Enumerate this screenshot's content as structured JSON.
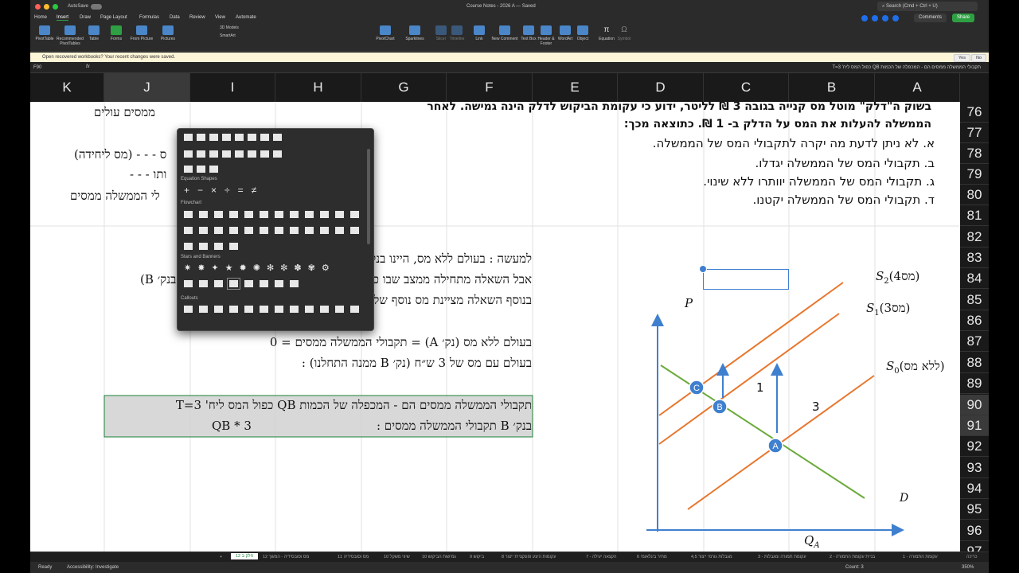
{
  "window": {
    "autosave_label": "AutoSave",
    "doc_title": "Course Notes - 2026 A — Saved",
    "search_placeholder": "Search (Cmd + Ctrl + U)"
  },
  "menu": {
    "tabs": [
      "Home",
      "Insert",
      "Draw",
      "Page Layout",
      "Formulas",
      "Data",
      "Review",
      "View",
      "Automate"
    ],
    "active": "Insert",
    "comments_label": "Comments",
    "share_label": "Share"
  },
  "ribbon": {
    "buttons": [
      "PivotTable",
      "Recommended PivotTables",
      "Table",
      "Forms",
      "From Picture",
      "Pictures"
    ],
    "smart_art": "SmartArt",
    "models_3d": "3D Models",
    "right_buttons": [
      "PivotChart",
      "Sparklines",
      "Slicer",
      "Timeline",
      "Link",
      "New Comment",
      "Text Box",
      "Header & Footer",
      "WordArt",
      "Object",
      "Equation",
      "Symbol"
    ]
  },
  "message_bar": {
    "text": "Open recovered workbooks? Your recent changes were saved.",
    "yes": "Yes",
    "no": "No"
  },
  "formula_bar": {
    "name_box": "F90",
    "fx": "fx",
    "content": "תקבולי הממשלה ממסים הם - המכפלה של הכמות QB כפול המס ליח' T=3"
  },
  "columns": [
    "K",
    "J",
    "I",
    "H",
    "G",
    "F",
    "E",
    "D",
    "C",
    "B",
    "A"
  ],
  "selected_column": "J",
  "rows": [
    "76",
    "77",
    "78",
    "79",
    "80",
    "81",
    "82",
    "83",
    "84",
    "85",
    "86",
    "87",
    "88",
    "89",
    "90",
    "91",
    "92",
    "93",
    "94",
    "95",
    "96",
    "97"
  ],
  "selected_rows": [
    "90",
    "91"
  ],
  "question": {
    "line1": "בשוק ה\"דלק\" מוטל מס קנייה בגובה 3 ₪ לליטר, ידוע כי עקומת הביקוש לדלק הינה גמישה. לאחר",
    "line2": "הממשלה להעלות את המס על הדלק ב- 1 ₪. כתוצאה מכך:",
    "options": [
      {
        "letter": "א.",
        "text": "לא ניתן לדעת מה יקרה לתקבולי המס של הממשלה."
      },
      {
        "letter": "ב.",
        "text": "תקבולי המס של הממשלה יגדלו."
      },
      {
        "letter": "ג.",
        "text": "תקבולי המס של הממשלה יוותרו ללא שינוי."
      },
      {
        "letter": "ד.",
        "text": "תקבולי המס של הממשלה יקטנו."
      }
    ]
  },
  "left_fragments": [
    "ממסים עולים",
    "ס - - - (מס ליחידה)",
    "ותו - - -",
    "לי הממשלה ממסים"
  ],
  "explanation": {
    "l1": "למעשה : בעולם ללא מס, היינו בנקודה A.",
    "l2": "אבל השאלה מתחילה ממצב שבו כבר הוטל מס של 3 ש״ח (השאלה מתחילה בנק׳ B)",
    "l3": "בנוסף השאלה מציינת מס נוסף של 1 ש״ח (מעבר לנקודה C).",
    "l4": "בעולם ללא מס (נק׳ A) = תקבולי הממשלה ממסים = 0",
    "l5": "בעולם עם מס של 3 ש״ח (נק׳ B ממנה התחלנו) :",
    "l6": "תקבולי הממשלה ממסים הם - המכפלה של הכמות QB כפול המס ליח' T=3",
    "l7": "בנק׳ B תקבולי הממשלה ממסים :",
    "l7b": "3 * QB"
  },
  "graph": {
    "p_label": "P",
    "q_label": "Q",
    "q_sub": "A",
    "d_label": "D",
    "s2_label": "S",
    "s2_sub": "2",
    "s2_rest": "(4מס)",
    "s1_label": "S",
    "s1_sub": "1",
    "s1_rest": "(3מס)",
    "s0_label": "S",
    "s0_sub": "0",
    "s0_rest": "(ללא מס)",
    "arrow_1": "1",
    "arrow_3": "3",
    "points": [
      "C",
      "B",
      "A"
    ],
    "supply_color": "#e8772e",
    "demand_color": "#6aaa3a",
    "axis_color": "#3f7fcf"
  },
  "shapes_dropdown": {
    "sections": [
      "Equation Shapes",
      "Flowchart",
      "Stars and Banners",
      "Callouts"
    ],
    "eq_symbols": [
      "+",
      "−",
      "×",
      "÷",
      "=",
      "≠"
    ]
  },
  "sheet_tabs": [
    "12 חלק ב",
    "12 מס וסובסידיה - המשך",
    "11 מס וסובסידיה",
    "10 שיווי משקל",
    "10 גמישות הביקוש",
    "9 ביקוש",
    "8 עקומות היצע ופונקציית ייצור",
    "7 - הקצאה יעילה",
    "6 מחיר בינלאומי",
    "4,5 מגבלות גורמי ייצור",
    "3 - עקומת תמורה ומגבלות",
    "2 - בניית עקומת התמורה",
    "1 - עקומת התמורה",
    "כריכה"
  ],
  "status": {
    "ready": "Ready",
    "accessibility": "Accessibility: Investigate",
    "count": "Count: 3",
    "zoom": "350%"
  }
}
